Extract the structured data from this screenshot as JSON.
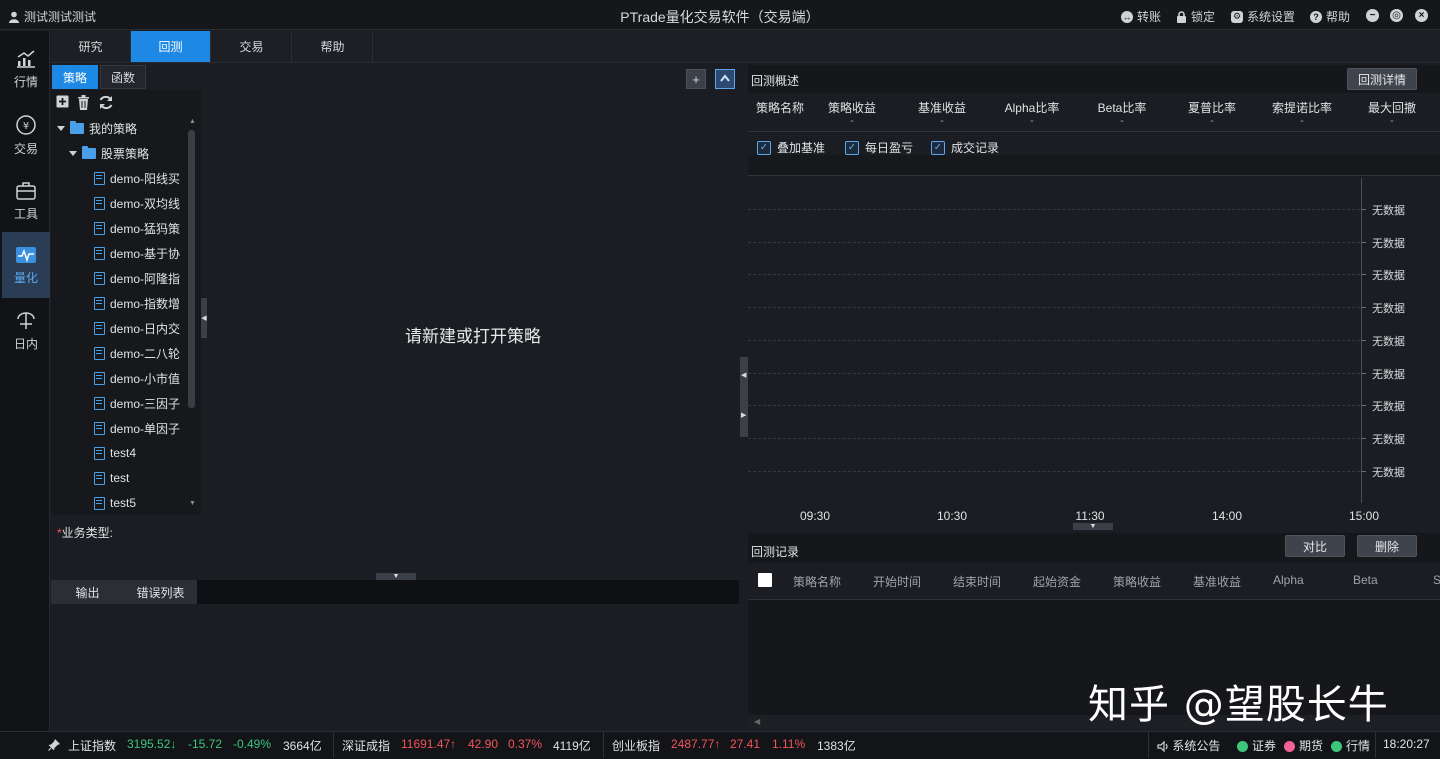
{
  "titlebar": {
    "user": "测试测试测试",
    "title": "PTrade量化交易软件（交易端）",
    "actions": [
      "转账",
      "锁定",
      "系统设置",
      "帮助"
    ]
  },
  "leftnav": [
    "行情",
    "交易",
    "工具",
    "量化",
    "日内"
  ],
  "toptabs": [
    "研究",
    "回测",
    "交易",
    "帮助"
  ],
  "lefttabs": [
    "策略",
    "函数"
  ],
  "tree": {
    "root": "我的策略",
    "folder": "股票策略",
    "files": [
      "demo-阳线买",
      "demo-双均线",
      "demo-猛犸策",
      "demo-基于协",
      "demo-阿隆指",
      "demo-指数增",
      "demo-日内交",
      "demo-二八轮",
      "demo-小市值",
      "demo-三因子",
      "demo-单因子",
      "test4",
      "test",
      "test5"
    ]
  },
  "editor": {
    "hint": "请新建或打开策略",
    "add": "+"
  },
  "biz": {
    "label": "业务类型:"
  },
  "bottomtabs": [
    "输出",
    "错误列表"
  ],
  "overview": {
    "title": "回测概述",
    "detail_button": "回测详情",
    "stats": [
      {
        "label": "策略名称",
        "value": ""
      },
      {
        "label": "策略收益",
        "value": "-"
      },
      {
        "label": "基准收益",
        "value": "-"
      },
      {
        "label": "Alpha比率",
        "value": "-"
      },
      {
        "label": "Beta比率",
        "value": "-"
      },
      {
        "label": "夏普比率",
        "value": "-"
      },
      {
        "label": "索提诺比率",
        "value": "-"
      },
      {
        "label": "最大回撤",
        "value": "-"
      }
    ],
    "checkboxes": [
      "叠加基准",
      "每日盈亏",
      "成交记录"
    ]
  },
  "chart_data": {
    "type": "line",
    "x": [
      "09:30",
      "10:30",
      "11:30",
      "14:00",
      "15:00"
    ],
    "y_tick_labels": [
      "无数据",
      "无数据",
      "无数据",
      "无数据",
      "无数据",
      "无数据",
      "无数据",
      "无数据",
      "无数据"
    ],
    "series": [],
    "grid": true
  },
  "records": {
    "title": "回测记录",
    "compare_button": "对比",
    "delete_button": "删除",
    "columns": [
      "策略名称",
      "开始时间",
      "结束时间",
      "起始资金",
      "策略收益",
      "基准收益",
      "Alpha",
      "Beta",
      "S"
    ]
  },
  "watermark": "知乎 @望股长牛",
  "statusbar": {
    "indices": [
      {
        "name": "上证指数",
        "price": "3195.52",
        "arrow": "↓",
        "change": "-15.72",
        "pct": "-0.49%",
        "volume": "3664亿",
        "color": "#3ec77b"
      },
      {
        "name": "深证成指",
        "price": "11691.47",
        "arrow": "↑",
        "change": "42.90",
        "pct": "0.37%",
        "volume": "4119亿",
        "color": "#f2545b"
      },
      {
        "name": "创业板指",
        "price": "2487.77",
        "arrow": "↑",
        "change": "27.41",
        "pct": "1.11%",
        "volume": "1383亿",
        "color": "#f2545b"
      }
    ],
    "notice": "系统公告",
    "connections": [
      {
        "name": "证券",
        "color": "#3ec77b"
      },
      {
        "name": "期货",
        "color": "#f06292"
      },
      {
        "name": "行情",
        "color": "#3ec77b"
      }
    ],
    "time": "18:20:27"
  }
}
